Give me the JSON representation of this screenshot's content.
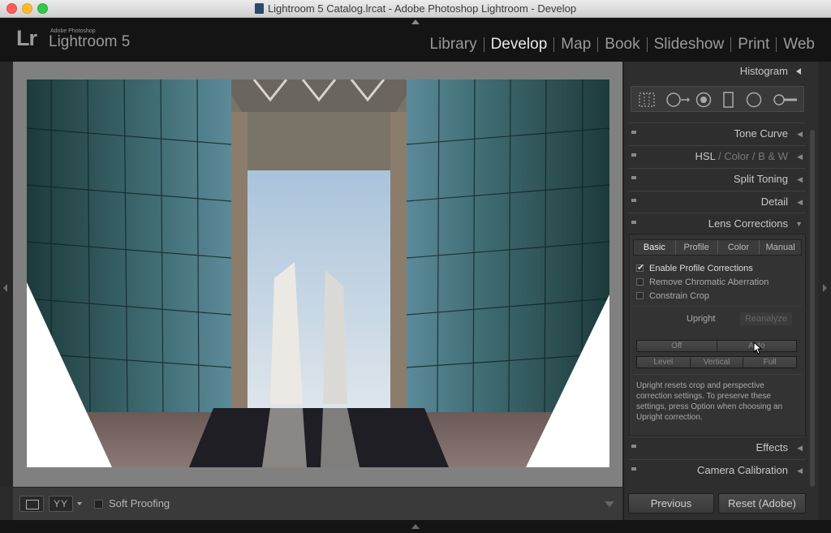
{
  "window": {
    "title": "Lightroom 5 Catalog.lrcat - Adobe Photoshop Lightroom - Develop"
  },
  "header": {
    "logo_mark": "Lr",
    "logo_brand": "Adobe Photoshop",
    "logo_name": "Lightroom 5",
    "modules": [
      "Library",
      "Develop",
      "Map",
      "Book",
      "Slideshow",
      "Print",
      "Web"
    ],
    "active_module": "Develop"
  },
  "toolbar": {
    "view_mode_label": "YY",
    "soft_proofing_label": "Soft Proofing",
    "soft_proofing_checked": false
  },
  "right_panel": {
    "histogram_label": "Histogram",
    "tools": [
      "crop-overlay-icon",
      "spot-removal-icon",
      "red-eye-icon",
      "graduated-filter-icon",
      "radial-filter-icon",
      "adjustment-brush-icon"
    ],
    "panels": {
      "tone_curve": "Tone Curve",
      "hsl": {
        "hsl": "HSL",
        "sep1": "/",
        "color": "Color",
        "sep2": "/",
        "bw": "B & W"
      },
      "split_toning": "Split Toning",
      "detail": "Detail",
      "lens_corrections": "Lens Corrections",
      "effects": "Effects",
      "camera_calibration": "Camera Calibration"
    },
    "lens": {
      "tabs": [
        "Basic",
        "Profile",
        "Color",
        "Manual"
      ],
      "active_tab": "Basic",
      "enable_profile": {
        "label": "Enable Profile Corrections",
        "checked": true
      },
      "remove_ca": {
        "label": "Remove Chromatic Aberration",
        "checked": false
      },
      "constrain_crop": {
        "label": "Constrain Crop",
        "checked": false
      },
      "upright_label": "Upright",
      "reanalyze_label": "Reanalyze",
      "upright_row1": [
        "Off",
        "Auto"
      ],
      "upright_row2": [
        "Level",
        "Vertical",
        "Full"
      ],
      "upright_help": "Upright resets crop and perspective correction settings. To preserve these settings, press Option when choosing an Upright correction."
    },
    "previous_label": "Previous",
    "reset_label": "Reset (Adobe)"
  },
  "colors": {
    "panel_bg": "#2e2e2e",
    "canvas_bg": "#808080",
    "active_text": "#e8e8e8"
  }
}
